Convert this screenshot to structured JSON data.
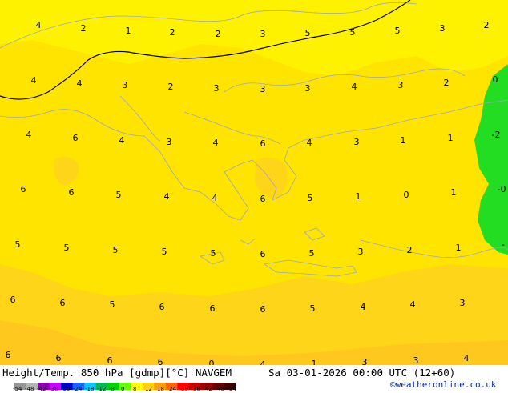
{
  "map": {
    "colors": {
      "base": "#ffe400",
      "band_light": "#fff200",
      "band_warm": "#ffd51a",
      "band_orange": "#ffc81e",
      "green": "#22dd22",
      "green_light": "#33ee33",
      "coast": "#9aa6c4",
      "contour": "#000000"
    },
    "values": [
      "4",
      "2",
      "1",
      "2",
      "2",
      "3",
      "5",
      "5",
      "5",
      "3",
      "2",
      "4",
      "4",
      "3",
      "2",
      "3",
      "3",
      "3",
      "4",
      "3",
      "2",
      "0",
      "4",
      "6",
      "4",
      "3",
      "4",
      "6",
      "4",
      "3",
      "1",
      "1",
      "-2",
      "6",
      "6",
      "5",
      "4",
      "4",
      "6",
      "5",
      "1",
      "0",
      "1",
      "-0",
      "5",
      "5",
      "5",
      "5",
      "5",
      "6",
      "5",
      "3",
      "2",
      "1",
      "-",
      "6",
      "6",
      "5",
      "6",
      "6",
      "6",
      "5",
      "4",
      "4",
      "3",
      "6",
      "6",
      "6",
      "6",
      "0",
      "4",
      "1",
      "3",
      "3",
      "4"
    ]
  },
  "footer": {
    "title": "Height/Temp. 850 hPa [gdmp][°C] NAVGEM",
    "datetime": "Sa 03-01-2026 00:00 UTC (12+60)",
    "credit": "©weatheronline.co.uk",
    "scale_labels": [
      "-54",
      "-48",
      "-42",
      "-38",
      "-30",
      "-24",
      "-18",
      "-12",
      "-8",
      "0",
      "8",
      "12",
      "18",
      "24",
      "30",
      "38",
      "42",
      "48",
      "54"
    ],
    "scale_colors": [
      "#969696",
      "#b4b4b4",
      "#8c00b4",
      "#c800ff",
      "#0000c8",
      "#1464ff",
      "#00c8ff",
      "#00b45a",
      "#00d200",
      "#64ff00",
      "#ffff00",
      "#ffd200",
      "#ffa000",
      "#ff6400",
      "#ff0000",
      "#c80000",
      "#960000",
      "#640000",
      "#3c0000"
    ]
  }
}
